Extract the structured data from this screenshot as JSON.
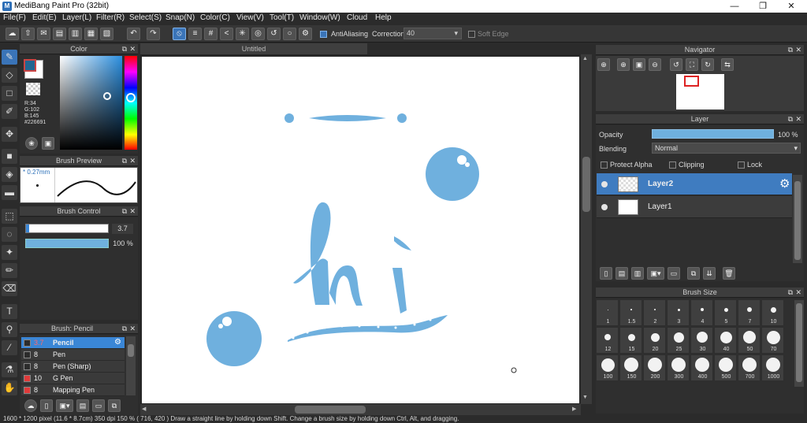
{
  "window": {
    "title": "MediBang Paint Pro (32bit)",
    "minimize": "—",
    "restore": "❐",
    "close": "✕"
  },
  "menu": [
    "File(F)",
    "Edit(E)",
    "Layer(L)",
    "Filter(R)",
    "Select(S)",
    "Snap(N)",
    "Color(C)",
    "View(V)",
    "Tool(T)",
    "Window(W)",
    "Cloud",
    "Help"
  ],
  "toolbar": {
    "antialiasing_label": "AntiAliasing",
    "correction_label": "Correction",
    "correction_value": "40",
    "soft_edge_label": "Soft Edge"
  },
  "color_panel": {
    "title": "Color",
    "r": "R:34",
    "g": "G:102",
    "b": "B:145",
    "hex": "#226691",
    "foreground": "#226691",
    "background": "#ffffff"
  },
  "brush_preview": {
    "title": "Brush Preview",
    "size": "* 0.27mm"
  },
  "brush_control": {
    "title": "Brush Control",
    "size_value": "3.7",
    "opacity_value": "100 %"
  },
  "brush_list": {
    "title": "Brush: Pencil",
    "items": [
      {
        "size": "3.7",
        "name": "Pencil",
        "swatch": "#2c2c2c",
        "selected": true
      },
      {
        "size": "8",
        "name": "Pen",
        "swatch": "#2c2c2c",
        "selected": false
      },
      {
        "size": "8",
        "name": "Pen (Sharp)",
        "swatch": "#2c2c2c",
        "selected": false
      },
      {
        "size": "10",
        "name": "G Pen",
        "swatch": "#e03a3a",
        "selected": false
      },
      {
        "size": "8",
        "name": "Mapping Pen",
        "swatch": "#e03a3a",
        "selected": false
      }
    ]
  },
  "canvas": {
    "tab_title": "Untitled",
    "stroke_color": "#6fb0de"
  },
  "navigator": {
    "title": "Navigator"
  },
  "layer_panel": {
    "title": "Layer",
    "opacity_label": "Opacity",
    "opacity_value": "100 %",
    "blending_label": "Blending",
    "blending_value": "Normal",
    "protect_alpha": "Protect Alpha",
    "clipping": "Clipping",
    "lock": "Lock",
    "layers": [
      {
        "name": "Layer2",
        "selected": true
      },
      {
        "name": "Layer1",
        "selected": false
      }
    ]
  },
  "brush_size": {
    "title": "Brush Size",
    "sizes": [
      "1",
      "1.5",
      "2",
      "3",
      "4",
      "5",
      "7",
      "10",
      "12",
      "15",
      "20",
      "25",
      "30",
      "40",
      "50",
      "70",
      "100",
      "150",
      "200",
      "300",
      "400",
      "500",
      "700",
      "1000"
    ]
  },
  "status": "1600 * 1200 pixel   (11.6 * 8.7cm)   350 dpi   150 %   ( 716, 420 )   Draw a straight line by holding down Shift. Change a brush size by holding down Ctrl, Alt, and dragging."
}
